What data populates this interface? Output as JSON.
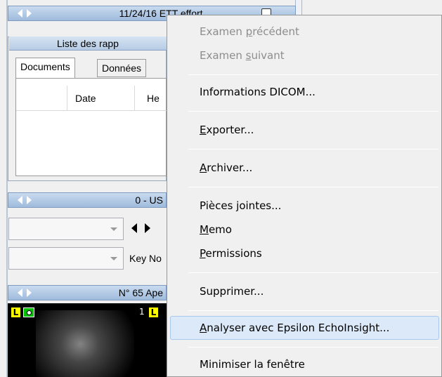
{
  "background": {
    "top_bar_title": "11/24/16 ETT effort",
    "report_list_title": "Liste des rapp",
    "tabs": [
      "Documents",
      "Données"
    ],
    "columns": [
      "Date",
      "He"
    ],
    "series_bar_title": "0 - US",
    "key_label": "Key No",
    "image_bar_title": "N° 65 Ape",
    "overlay_L1": "L",
    "overlay_L2": "L",
    "overlay_1": "1"
  },
  "menu": {
    "items": [
      {
        "pre": "Examen ",
        "mn": "p",
        "post": "récédent",
        "disabled": true
      },
      {
        "pre": "Examen ",
        "mn": "s",
        "post": "uivant",
        "disabled": true
      },
      {
        "pre": "",
        "mn": "",
        "post": "Informations DICOM...",
        "disabled": false
      },
      {
        "pre": "",
        "mn": "E",
        "post": "xporter...",
        "disabled": false
      },
      {
        "pre": "",
        "mn": "A",
        "post": "rchiver...",
        "disabled": false
      },
      {
        "pre": "",
        "mn": "",
        "post": "Pièces jointes...",
        "disabled": false
      },
      {
        "pre": "",
        "mn": "M",
        "post": "emo",
        "disabled": false
      },
      {
        "pre": "",
        "mn": "P",
        "post": "ermissions",
        "disabled": false
      },
      {
        "pre": "",
        "mn": "",
        "post": "Supprimer...",
        "disabled": false
      },
      {
        "pre": "",
        "mn": "A",
        "post": "nalyser avec Epsilon EchoInsight...",
        "disabled": false,
        "highlighted": true
      },
      {
        "pre": "",
        "mn": "",
        "post": "Minimiser la fenêtre",
        "disabled": false
      }
    ]
  },
  "colors": {
    "menu_bg": "#f0f0f0",
    "highlight": "#dce9f8",
    "disabled_text": "#8d8d8d",
    "titlebar": "#b6cbe4"
  }
}
